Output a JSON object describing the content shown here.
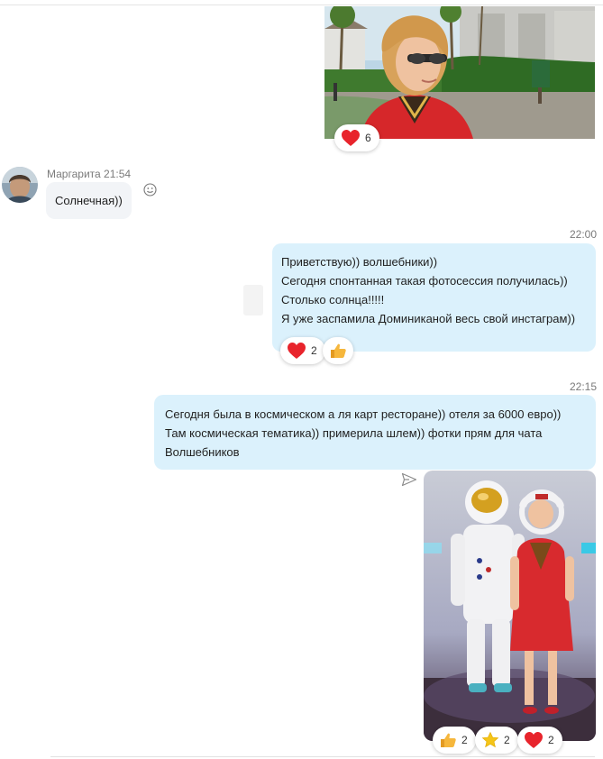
{
  "messages": [
    {
      "type": "photo",
      "reactions": [
        {
          "icon": "heart-icon",
          "count": "6"
        }
      ]
    },
    {
      "type": "incoming",
      "sender": "Маргарита",
      "time": "21:54",
      "text": "Солнечная))"
    },
    {
      "type": "outgoing",
      "time": "22:00",
      "lines": [
        "Приветствую)) волшебники))",
        "Сегодня спонтанная такая фотосессия получилась))",
        "Столько солнца!!!!!",
        "Я уже заспамила Доминиканой весь свой инстаграм))"
      ],
      "reactions": [
        {
          "icon": "heart-icon",
          "count": "2"
        },
        {
          "icon": "thumbs-up-icon",
          "count": ""
        }
      ]
    },
    {
      "type": "outgoing",
      "time": "22:15",
      "lines": [
        "Сегодня была в космическом а ля карт ресторане)) отеля за 6000 евро))",
        "Там космическая тематика)) примерила шлем)) фотки прям для чата",
        "Волшебников"
      ]
    },
    {
      "type": "photo",
      "reactions": [
        {
          "icon": "thumbs-up-icon",
          "count": "2"
        },
        {
          "icon": "star-icon",
          "count": "2"
        },
        {
          "icon": "heart-icon",
          "count": "2"
        }
      ]
    }
  ],
  "colors": {
    "outgoing_bubble": "#dbf1fc",
    "incoming_bubble": "#f2f4f7",
    "heart": "#e8242c",
    "thumbs": "#f6b73c",
    "star": "#f5c518"
  }
}
